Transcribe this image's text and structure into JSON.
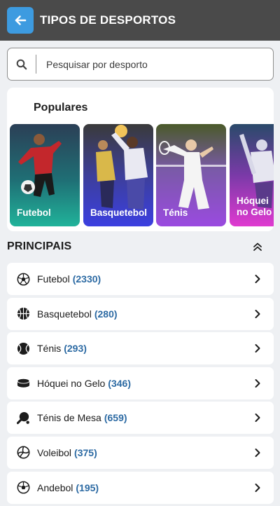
{
  "header": {
    "title": "TIPOS DE DESPORTOS"
  },
  "search": {
    "placeholder": "Pesquisar por desporto",
    "value": ""
  },
  "popular": {
    "title": "Populares",
    "tiles": [
      {
        "label": "Futebol"
      },
      {
        "label": "Basquetebol"
      },
      {
        "label": "Ténis"
      },
      {
        "label": "Hóquei no Gelo"
      }
    ]
  },
  "section": {
    "title": "PRINCIPAIS"
  },
  "sports": [
    {
      "name": "Futebol",
      "count": "(2330)",
      "icon": "soccer-ball-icon"
    },
    {
      "name": "Basquetebol",
      "count": "(280)",
      "icon": "basketball-icon"
    },
    {
      "name": "Ténis",
      "count": "(293)",
      "icon": "tennis-ball-icon"
    },
    {
      "name": "Hóquei no Gelo",
      "count": "(346)",
      "icon": "hockey-puck-icon"
    },
    {
      "name": "Ténis de Mesa",
      "count": "(659)",
      "icon": "table-tennis-icon"
    },
    {
      "name": "Voleibol",
      "count": "(375)",
      "icon": "volleyball-icon"
    },
    {
      "name": "Andebol",
      "count": "(195)",
      "icon": "handball-icon"
    }
  ],
  "colors": {
    "header_bg": "#4a4a4a",
    "accent": "#3d9be0",
    "count_text": "#2c6aa3",
    "tile_football": "#1f8f6b",
    "tile_basketball": "#3b3fcf",
    "tile_tennis": "#8b3fd9",
    "tile_hockey": "#d93fc9"
  }
}
